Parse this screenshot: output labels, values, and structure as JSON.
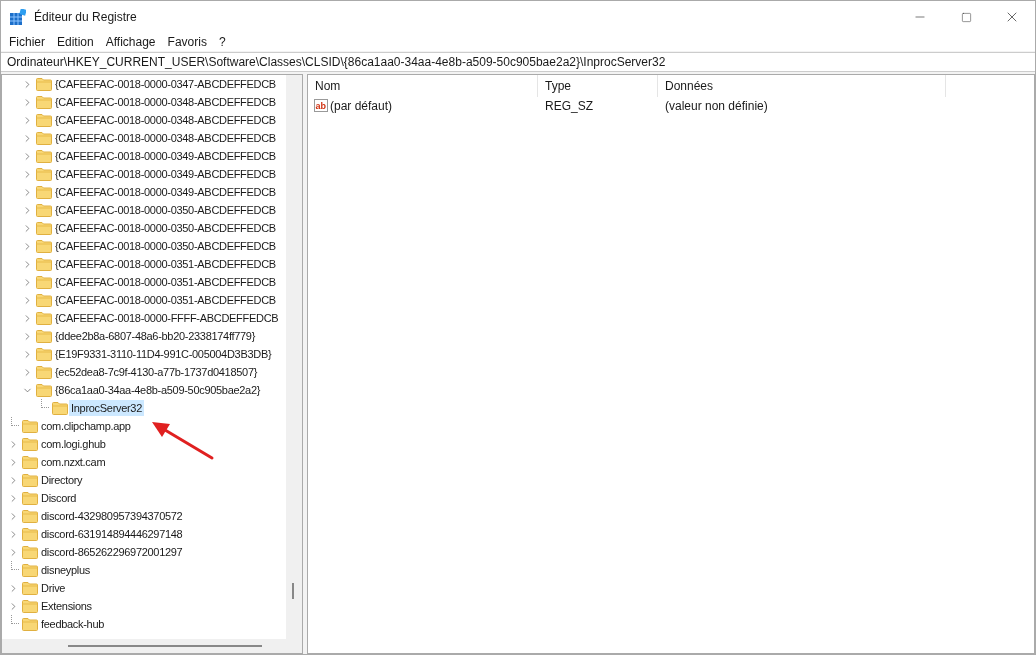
{
  "window": {
    "title": "Éditeur du Registre"
  },
  "menu": [
    "Fichier",
    "Edition",
    "Affichage",
    "Favoris",
    "?"
  ],
  "address": "Ordinateur\\HKEY_CURRENT_USER\\Software\\Classes\\CLSID\\{86ca1aa0-34aa-4e8b-a509-50c905bae2a2}\\InprocServer32",
  "tree": {
    "nested_items": [
      {
        "label": "{CAFEEFAC-0018-0000-0347-ABCDEFFEDCB",
        "has_children": true,
        "expanded": false,
        "selected": false
      },
      {
        "label": "{CAFEEFAC-0018-0000-0348-ABCDEFFEDCB",
        "has_children": true,
        "expanded": false,
        "selected": false
      },
      {
        "label": "{CAFEEFAC-0018-0000-0348-ABCDEFFEDCB",
        "has_children": true,
        "expanded": false,
        "selected": false
      },
      {
        "label": "{CAFEEFAC-0018-0000-0348-ABCDEFFEDCB",
        "has_children": true,
        "expanded": false,
        "selected": false
      },
      {
        "label": "{CAFEEFAC-0018-0000-0349-ABCDEFFEDCB",
        "has_children": true,
        "expanded": false,
        "selected": false
      },
      {
        "label": "{CAFEEFAC-0018-0000-0349-ABCDEFFEDCB",
        "has_children": true,
        "expanded": false,
        "selected": false
      },
      {
        "label": "{CAFEEFAC-0018-0000-0349-ABCDEFFEDCB",
        "has_children": true,
        "expanded": false,
        "selected": false
      },
      {
        "label": "{CAFEEFAC-0018-0000-0350-ABCDEFFEDCB",
        "has_children": true,
        "expanded": false,
        "selected": false
      },
      {
        "label": "{CAFEEFAC-0018-0000-0350-ABCDEFFEDCB",
        "has_children": true,
        "expanded": false,
        "selected": false
      },
      {
        "label": "{CAFEEFAC-0018-0000-0350-ABCDEFFEDCB",
        "has_children": true,
        "expanded": false,
        "selected": false
      },
      {
        "label": "{CAFEEFAC-0018-0000-0351-ABCDEFFEDCB",
        "has_children": true,
        "expanded": false,
        "selected": false
      },
      {
        "label": "{CAFEEFAC-0018-0000-0351-ABCDEFFEDCB",
        "has_children": true,
        "expanded": false,
        "selected": false
      },
      {
        "label": "{CAFEEFAC-0018-0000-0351-ABCDEFFEDCB",
        "has_children": true,
        "expanded": false,
        "selected": false
      },
      {
        "label": "{CAFEEFAC-0018-0000-FFFF-ABCDEFFEDCB",
        "has_children": true,
        "expanded": false,
        "selected": false
      },
      {
        "label": "{ddee2b8a-6807-48a6-bb20-2338174ff779}",
        "has_children": true,
        "expanded": false,
        "selected": false
      },
      {
        "label": "{E19F9331-3110-11D4-991C-005004D3B3DB}",
        "has_children": true,
        "expanded": false,
        "selected": false
      },
      {
        "label": "{ec52dea8-7c9f-4130-a77b-1737d0418507}",
        "has_children": true,
        "expanded": false,
        "selected": false
      },
      {
        "label": "{86ca1aa0-34aa-4e8b-a509-50c905bae2a2}",
        "has_children": true,
        "expanded": true,
        "selected": false,
        "children": [
          {
            "label": "InprocServer32",
            "has_children": false,
            "selected": true
          }
        ]
      }
    ],
    "items": [
      {
        "label": "com.clipchamp.app",
        "has_children": false,
        "selected": false
      },
      {
        "label": "com.logi.ghub",
        "has_children": true,
        "expanded": false,
        "selected": false
      },
      {
        "label": "com.nzxt.cam",
        "has_children": true,
        "expanded": false,
        "selected": false
      },
      {
        "label": "Directory",
        "has_children": true,
        "expanded": false,
        "selected": false
      },
      {
        "label": "Discord",
        "has_children": true,
        "expanded": false,
        "selected": false
      },
      {
        "label": "discord-432980957394370572",
        "has_children": true,
        "expanded": false,
        "selected": false
      },
      {
        "label": "discord-631914894446297148",
        "has_children": true,
        "expanded": false,
        "selected": false
      },
      {
        "label": "discord-865262296972001297",
        "has_children": true,
        "expanded": false,
        "selected": false
      },
      {
        "label": "disneyplus",
        "has_children": false,
        "selected": false
      },
      {
        "label": "Drive",
        "has_children": true,
        "expanded": false,
        "selected": false
      },
      {
        "label": "Extensions",
        "has_children": true,
        "expanded": false,
        "selected": false
      },
      {
        "label": "feedback-hub",
        "has_children": false,
        "selected": false
      }
    ]
  },
  "values": {
    "columns": [
      "Nom",
      "Type",
      "Données"
    ],
    "rows": [
      {
        "kind": "string",
        "icon": "ab",
        "name": "(par défaut)",
        "type": "REG_SZ",
        "data": "(valeur non définie)"
      }
    ]
  }
}
